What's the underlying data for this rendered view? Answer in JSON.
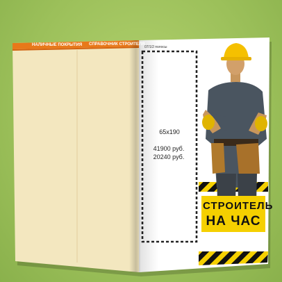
{
  "left_page": {
    "header_left": "НАЛИЧНЫЕ ПОКРЫТИЯ",
    "header_right": "СПРАВОЧНИК СТРОИТЕЛЯ"
  },
  "right_page": {
    "label": "07/1/2 полосы",
    "ad_size": "65x190",
    "price_1": "41900 руб.",
    "price_2": "20240 руб.",
    "badge_line1": "СТРОИТЕЛЬ",
    "badge_line2": "НА ЧАС"
  },
  "colors": {
    "background": "#9cc05a",
    "header_orange": "#e8791a",
    "left_page": "#f3e7bf",
    "badge": "#f5d000"
  }
}
